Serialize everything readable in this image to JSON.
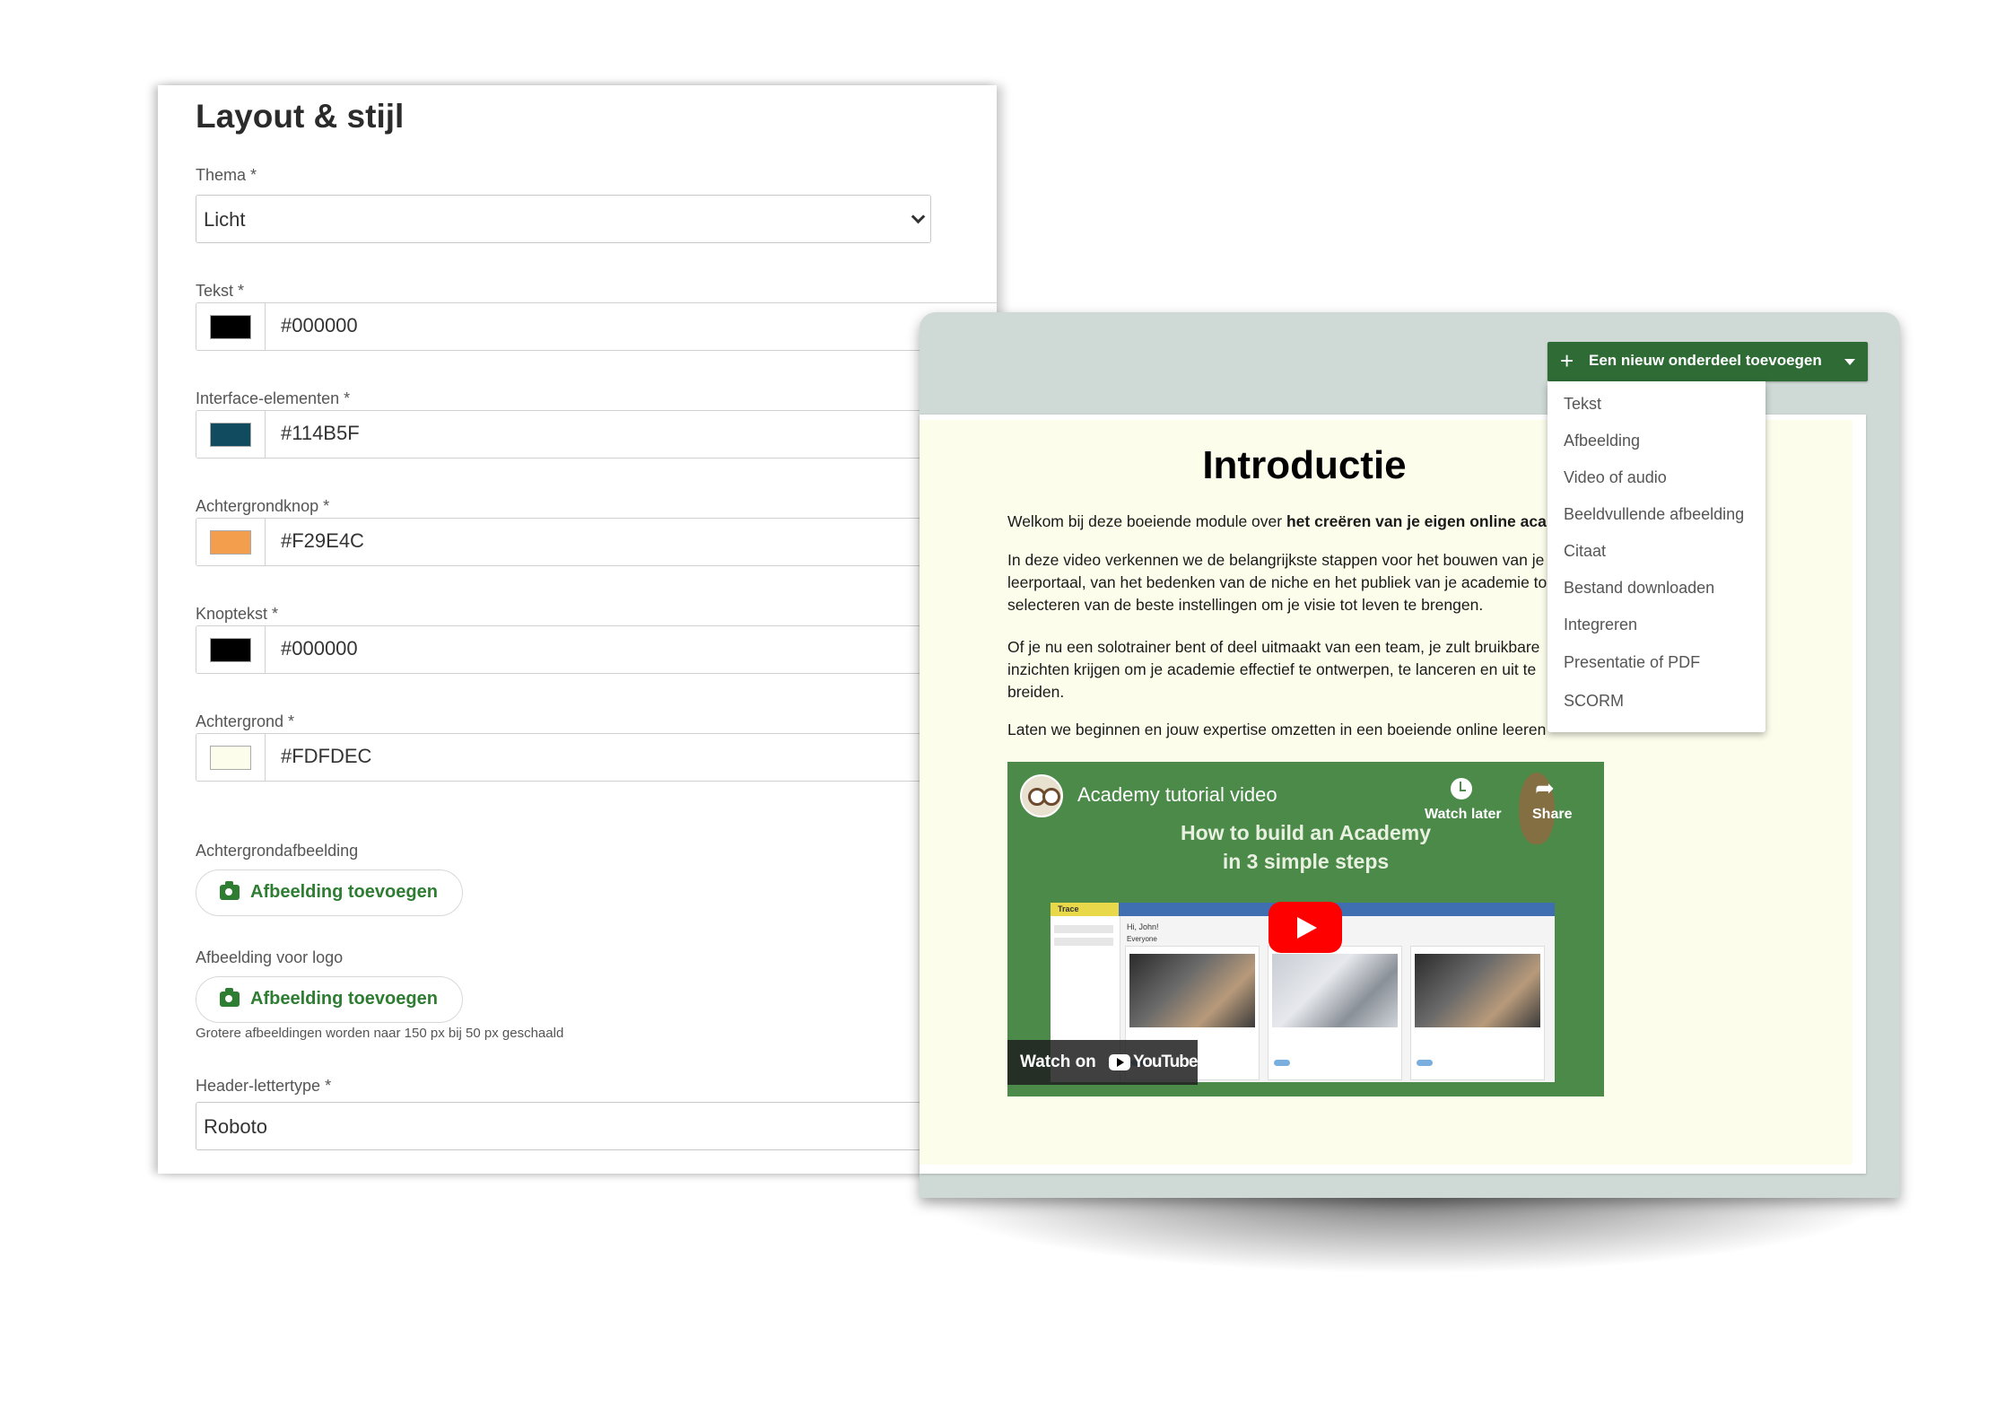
{
  "settings": {
    "title": "Layout & stijl",
    "theme": {
      "label": "Thema *",
      "value": "Licht"
    },
    "colors": [
      {
        "label": "Tekst *",
        "hex": "#000000",
        "swatch": "#000000"
      },
      {
        "label": "Interface-elementen *",
        "hex": "#114B5F",
        "swatch": "#114B5F"
      },
      {
        "label": "Achtergrondknop *",
        "hex": "#F29E4C",
        "swatch": "#F29E4C"
      },
      {
        "label": "Knoptekst *",
        "hex": "#000000",
        "swatch": "#000000"
      },
      {
        "label": "Achtergrond *",
        "hex": "#FDFDEC",
        "swatch": "#FDFDEC"
      }
    ],
    "background_image": {
      "label": "Achtergrondafbeelding",
      "button": "Afbeelding toevoegen"
    },
    "logo_image": {
      "label": "Afbeelding voor logo",
      "button": "Afbeelding toevoegen",
      "hint": "Grotere afbeeldingen worden naar 150 px bij 50 px geschaald"
    },
    "header_font": {
      "label": "Header-lettertype *",
      "value": "Roboto"
    }
  },
  "preview": {
    "add_button": "Een nieuw onderdeel toevoegen",
    "menu": [
      "Tekst",
      "Afbeelding",
      "Video of audio",
      "Beeldvullende afbeelding",
      "Citaat",
      "Bestand downloaden",
      "Integreren",
      "Presentatie of PDF",
      "SCORM"
    ],
    "title": "Introductie",
    "p1_normal": "Welkom bij deze boeiende module over ",
    "p1_bold": "het creëren van je eigen online aca",
    "p2": [
      "In deze video verkennen we de belangrijkste stappen voor het bouwen van je",
      "leerportaal, van het bedenken van de niche en het publiek van je academie to",
      "selecteren van de beste instellingen om je visie tot leven te brengen."
    ],
    "p3": [
      "Of je nu een solotrainer bent of deel uitmaakt van een team, je zult bruikbare",
      "inzichten krijgen om je academie effectief te ontwerpen, te lanceren en uit te",
      "breiden."
    ],
    "p4": "Laten we beginnen en jouw expertise omzetten in een boeiende online leeren",
    "video": {
      "title": "Academy tutorial video",
      "watch_later": "Watch later",
      "share": "Share",
      "headline1": "How to build an Academy",
      "headline2": "in 3 simple steps",
      "watch_on": "Watch on",
      "youtube": "YouTube",
      "mock_logo": "Trace",
      "mock_greeting": "Hi, John!",
      "mock_filter": "Everyone"
    }
  }
}
